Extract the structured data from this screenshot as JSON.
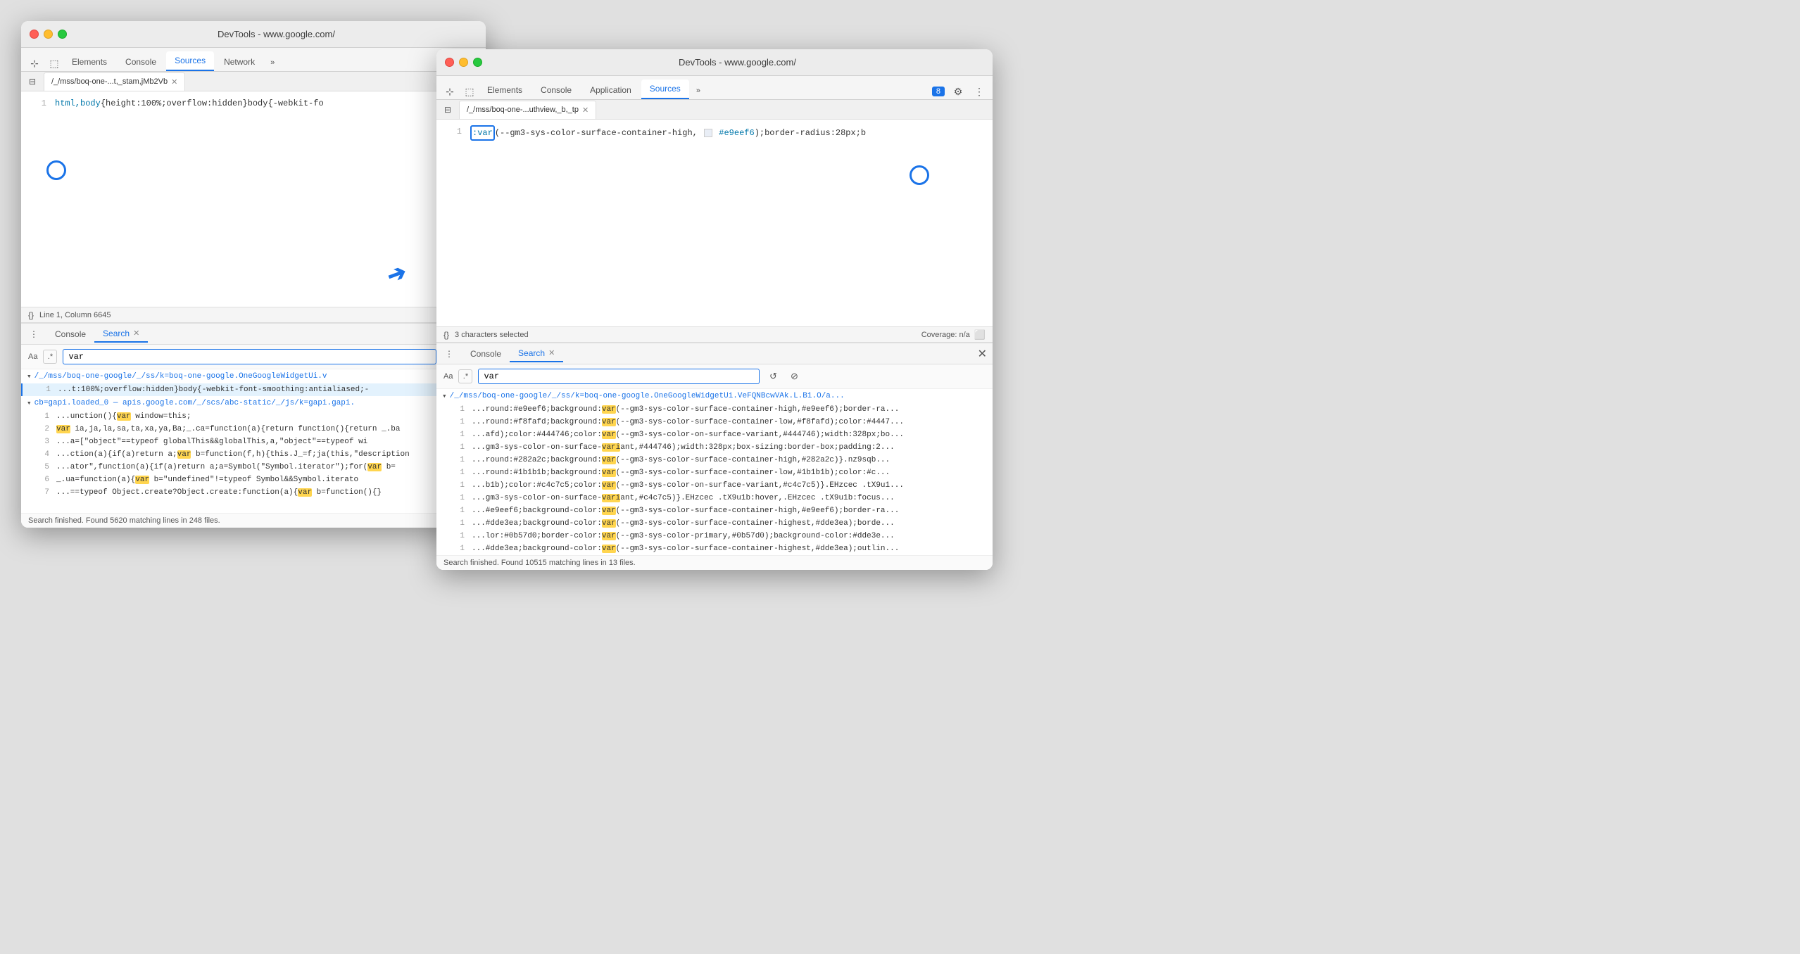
{
  "leftWindow": {
    "titleBar": {
      "title": "DevTools - www.google.com/"
    },
    "tabs": [
      {
        "label": "Elements",
        "active": false
      },
      {
        "label": "Console",
        "active": false
      },
      {
        "label": "Sources",
        "active": true
      },
      {
        "label": "Network",
        "active": false
      },
      {
        "label": "»",
        "active": false
      }
    ],
    "fileTab": {
      "name": "/_/mss/boq-one-...t,_stam,jMb2Vb",
      "hasClose": true
    },
    "code": {
      "lineNum": 1,
      "text": "html,body{height:100%;overflow:hidden}body{-webkit-fo"
    },
    "statusBar": {
      "text": "Line 1, Column 6645"
    },
    "bottomPanel": {
      "tabs": [
        {
          "label": "Console",
          "active": false
        },
        {
          "label": "Search",
          "active": true
        },
        {
          "hasClose": true
        }
      ],
      "searchBar": {
        "aaLabel": "Aa",
        "regexLabel": ".*",
        "inputValue": "var",
        "inputPlaceholder": ""
      },
      "results": [
        {
          "fileHeader": "▾/_/mss/boq-one-google/_/ss/k=boq-one-google.OneGoogleWidgetUi.v",
          "rows": [
            {
              "lineNum": "1",
              "text": "...t:100%;overflow:hidden}body{-webkit-font-smoothing:antialiased;-",
              "highlight": ""
            }
          ]
        },
        {
          "fileHeader": "▾cb=gapi.loaded_0  —  apis.google.com/_/scs/abc-static/_/js/k=gapi.gapi.",
          "rows": [
            {
              "lineNum": "1",
              "text": "...unction(){",
              "highlight": "var",
              "after": " window=this;"
            },
            {
              "lineNum": "2",
              "text": "",
              "highlight": "var",
              "before": " ia,ja,la,sa,ta,xa,ya,Ba;_.ca=function(a){return function(){return _.ba"
            },
            {
              "lineNum": "3",
              "text": "...a=[\"object\"==typeof globalThis&&globalThis,a,\"object\"==typeof wi"
            },
            {
              "lineNum": "4",
              "text": "...ction(a){if(a)return a;",
              "highlight": "var",
              "after": " b=function(f,h){this.J_=f;ja(this,\"description"
            },
            {
              "lineNum": "5",
              "text": "...ator\",function(a){if(a)return a;a=Symbol(\"Symbol.iterator\");for(",
              "highlight": "var",
              "after": " b="
            },
            {
              "lineNum": "6",
              "text": "_.ua=function(a){",
              "highlight": "var",
              "after": " b=\"undefined\"!=typeof Symbol&&Symbol.iterato"
            },
            {
              "lineNum": "7",
              "text": "...==typeof Object.create?Object.create:function(a){",
              "highlight": "var",
              "after": " b=function(){}"
            }
          ]
        }
      ],
      "statusText": "Search finished.  Found 5620 matching lines in 248 files."
    }
  },
  "rightWindow": {
    "titleBar": {
      "title": "DevTools - www.google.com/"
    },
    "tabs": [
      {
        "label": "Elements",
        "active": false
      },
      {
        "label": "Console",
        "active": false
      },
      {
        "label": "Application",
        "active": false
      },
      {
        "label": "Sources",
        "active": true
      },
      {
        "label": "»",
        "active": false
      }
    ],
    "badgeCount": "8",
    "fileTab": {
      "name": "/_/mss/boq-one-...uthview,_b,_tp",
      "hasClose": true
    },
    "code": {
      "lineNum": 1,
      "varKeyword": ":var",
      "text": "(--gm3-sys-color-surface-container-high,",
      "colorSwatch": "#e9eef6",
      "textAfter": " #e9eef6);border-radius:28px;b"
    },
    "statusBar": {
      "text": "3 characters selected",
      "coverage": "Coverage: n/a"
    },
    "bottomPanel": {
      "tabs": [
        {
          "label": "Console",
          "active": false
        },
        {
          "label": "Search",
          "active": true
        },
        {
          "hasClose": true
        }
      ],
      "searchBar": {
        "aaLabel": "Aa",
        "regexLabel": ".*",
        "inputValue": "var"
      },
      "results": [
        {
          "fileHeader": "▾/_/mss/boq-one-google/_/ss/k=boq-one-google.OneGoogleWidgetUi.VeFQNBcwVAk.L.B1.O/a...",
          "rows": [
            {
              "lineNum": "1",
              "before": "...round:#e9eef6;background:",
              "highlight": "var",
              "after": "(--gm3-sys-color-surface-container-high,#e9eef6);border-ra..."
            },
            {
              "lineNum": "1",
              "before": "...round:#f8fafd;background:",
              "highlight": "var",
              "after": "(--gm3-sys-color-surface-container-low,#f8fafd);color:#4447..."
            },
            {
              "lineNum": "1",
              "before": "...afd);color:#444746;color:",
              "highlight": "var",
              "after": "(--gm3-sys-color-on-surface-variant,#444746);width:328px;bo..."
            },
            {
              "lineNum": "1",
              "before": "...gm3-sys-color-on-surface-variant,#444746);width:328px;box-sizing:border-box;padding:2..."
            },
            {
              "lineNum": "1",
              "before": "...round:#282a2c;background:",
              "highlight": "var",
              "after": "(--gm3-sys-color-surface-container-high,#282a2c)}.nz9sqb..."
            },
            {
              "lineNum": "1",
              "before": "...round:#1b1b1b;background:",
              "highlight": "var",
              "after": "(--gm3-sys-color-surface-container-low,#1b1b1b);color:#c..."
            },
            {
              "lineNum": "1",
              "before": "...b1b);color:#c4c7c5;color:",
              "highlight": "var",
              "after": "(--gm3-sys-color-on-surface-variant,#c4c7c5)}.EHzcec .tX9u1..."
            },
            {
              "lineNum": "1",
              "before": "...gm3-sys-color-on-surface-variant,#c4c7c5)}.EHzcec .tX9u1b:hover,.EHzcec .tX9u1b:focus..."
            },
            {
              "lineNum": "1",
              "before": "...#e9eef6;background-color:",
              "highlight": "var",
              "after": "(--gm3-sys-color-surface-container-high,#e9eef6);border-ra..."
            },
            {
              "lineNum": "1",
              "before": "...#dde3ea;background-color:",
              "highlight": "var",
              "after": "(--gm3-sys-color-surface-container-highest,#dde3ea);borde..."
            },
            {
              "lineNum": "1",
              "before": "...lor:#0b57d0;border-color:",
              "highlight": "var",
              "after": "(--gm3-sys-color-primary,#0b57d0);background-color:#dde3e..."
            },
            {
              "lineNum": "1",
              "before": "...#dde3ea;background-color:",
              "highlight": "var",
              "after": "(--gm3-sys-color-surface-container-highest,#dde3ea);outlin..."
            }
          ]
        }
      ],
      "statusText": "Search finished.  Found 10515 matching lines in 13 files."
    }
  }
}
